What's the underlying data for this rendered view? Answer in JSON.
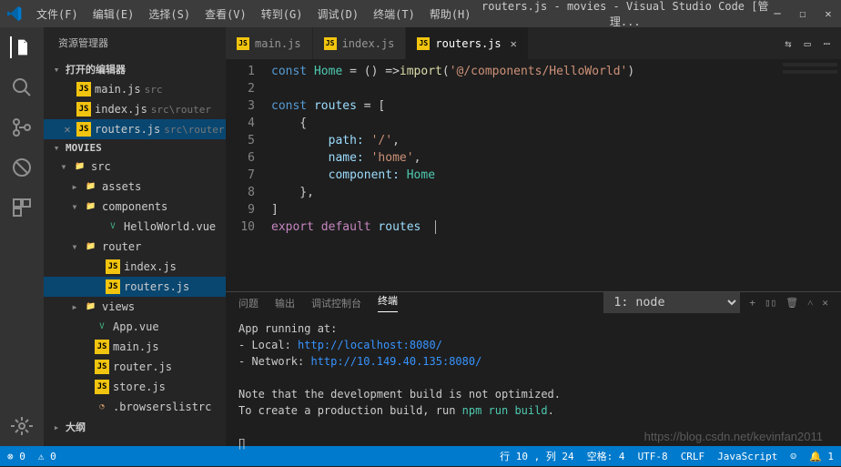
{
  "title": "routers.js - movies - Visual Studio Code [管理...",
  "menu": [
    "文件(F)",
    "编辑(E)",
    "选择(S)",
    "查看(V)",
    "转到(G)",
    "调试(D)",
    "终端(T)",
    "帮助(H)"
  ],
  "sidebar": {
    "title": "资源管理器",
    "sec1": "打开的编辑器",
    "open": [
      {
        "icon": "JS",
        "label": "main.js",
        "hint": "src"
      },
      {
        "icon": "JS",
        "label": "index.js",
        "hint": "src\\router"
      },
      {
        "icon": "JS",
        "label": "routers.js",
        "hint": "src\\router",
        "sel": true,
        "close": true
      }
    ],
    "sec2": "MOVIES",
    "tree": [
      {
        "ind": 12,
        "chev": "▾",
        "icon": "📁",
        "cls": "ico-folder",
        "label": "src"
      },
      {
        "ind": 24,
        "chev": "▸",
        "icon": "📁",
        "cls": "ico-folder2",
        "label": "assets"
      },
      {
        "ind": 24,
        "chev": "▾",
        "icon": "📁",
        "cls": "ico-folder",
        "label": "components"
      },
      {
        "ind": 48,
        "icon": "V",
        "cls": "ico-vue",
        "label": "HelloWorld.vue"
      },
      {
        "ind": 24,
        "chev": "▾",
        "icon": "📁",
        "cls": "ico-folder",
        "label": "router"
      },
      {
        "ind": 48,
        "icon": "JS",
        "cls": "ico-js",
        "label": "index.js"
      },
      {
        "ind": 48,
        "icon": "JS",
        "cls": "ico-js",
        "label": "routers.js",
        "sel": true
      },
      {
        "ind": 24,
        "chev": "▸",
        "icon": "📁",
        "cls": "ico-folder2",
        "label": "views"
      },
      {
        "ind": 36,
        "icon": "V",
        "cls": "ico-vue",
        "label": "App.vue"
      },
      {
        "ind": 36,
        "icon": "JS",
        "cls": "ico-js",
        "label": "main.js"
      },
      {
        "ind": 36,
        "icon": "JS",
        "cls": "ico-js",
        "label": "router.js"
      },
      {
        "ind": 36,
        "icon": "JS",
        "cls": "ico-js",
        "label": "store.js"
      },
      {
        "ind": 36,
        "icon": "◔",
        "cls": "",
        "label": ".browserslistrc",
        "iconColor": "#d19a66"
      }
    ],
    "sec3": "大纲"
  },
  "tabs": [
    {
      "icon": "JS",
      "label": "main.js"
    },
    {
      "icon": "JS",
      "label": "index.js"
    },
    {
      "icon": "JS",
      "label": "routers.js",
      "active": true
    }
  ],
  "code": {
    "lines": [
      {
        "n": 1,
        "html": "<span class='k1'>const</span> <span class='cls'>Home</span> = () =><span class='fn'>import</span>(<span class='str'>'@/components/HelloWorld'</span>)"
      },
      {
        "n": 2,
        "html": ""
      },
      {
        "n": 3,
        "html": "<span class='k1'>const</span> <span class='k2'>routes</span> = ["
      },
      {
        "n": 4,
        "html": "    {"
      },
      {
        "n": 5,
        "html": "        <span class='k2'>path:</span> <span class='str'>'/'</span>,"
      },
      {
        "n": 6,
        "html": "        <span class='k2'>name:</span> <span class='str'>'home'</span>,"
      },
      {
        "n": 7,
        "html": "        <span class='k2'>component:</span> <span class='cls'>Home</span>"
      },
      {
        "n": 8,
        "html": "    },"
      },
      {
        "n": 9,
        "html": "]"
      },
      {
        "n": 10,
        "html": "<span class='k3'>export</span> <span class='k3'>default</span> <span class='k2'>routes</span>  <span style='border-left:1px solid #aeafad;padding-left:1px'></span>"
      }
    ]
  },
  "panel": {
    "tabs": [
      "问题",
      "输出",
      "调试控制台",
      "终端"
    ],
    "active": 3,
    "select": "1: node",
    "term": {
      "l1": "App running at:",
      "l2": "- Local:   ",
      "u1": "http://localhost:8080/",
      "l3": "- Network: ",
      "u2": "http://10.149.40.135:8080/",
      "l4": "Note that the development build is not optimized.",
      "l5": "To create a production build, run ",
      "cmd": "npm run build",
      "dot": ".",
      "prompt": "∏"
    }
  },
  "status": {
    "err": "⊗ 0",
    "warn": "⚠ 0",
    "pos": "行 10 , 列 24",
    "spaces": "空格: 4",
    "enc": "UTF-8",
    "eol": "CRLF",
    "lang": "JavaScript",
    "feedback": "☺",
    "bell": "🔔 1"
  },
  "watermark": "https://blog.csdn.net/kevinfan2011"
}
